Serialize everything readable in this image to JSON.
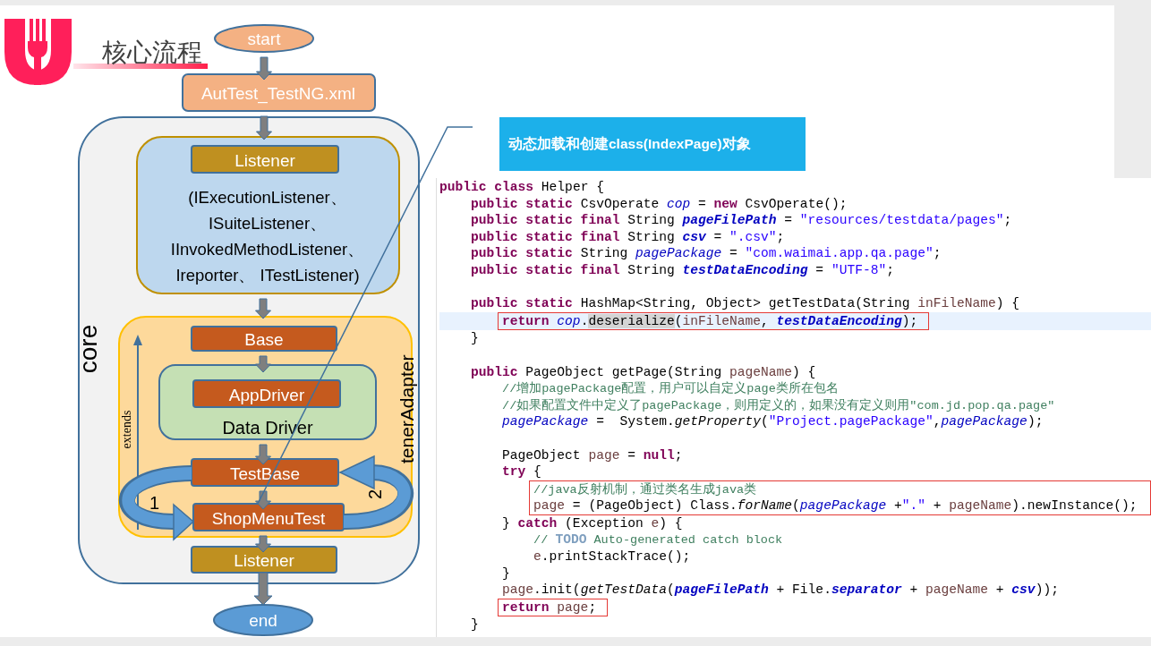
{
  "slide": {
    "title": "核心流程"
  },
  "flow": {
    "start": "start",
    "config_file": "AutTest_TestNG.xml",
    "container": "core",
    "listener_panel": {
      "title": "Listener",
      "lines": [
        "(IExecutionListener、",
        "ISuiteListener、",
        "IInvokedMethodListener、",
        "Ireporter、 ITestListener)"
      ]
    },
    "base": "Base",
    "driver_panel": {
      "title": "AppDriver",
      "label": "Data Driver"
    },
    "extends": "extends",
    "test_base": "TestBase",
    "test_class": "ShopMenuTest",
    "adapter": "tenerAdapter",
    "loop_labels": [
      "1",
      "2"
    ],
    "listener": "Listener",
    "end": "end"
  },
  "callout": {
    "text": "动态加载和创建class(IndexPage)对象"
  },
  "code": {
    "lines": [
      {
        "kind": "code",
        "tokens": [
          {
            "kind": "kw",
            "text": "public class"
          },
          {
            "kind": "p",
            "text": " Helper {"
          }
        ]
      },
      {
        "kind": "code",
        "tokens": [
          {
            "kind": "kw",
            "text": "    public static"
          },
          {
            "kind": "p",
            "text": " CsvOperate "
          },
          {
            "kind": "sf",
            "text": "cop"
          },
          {
            "kind": "p",
            "text": " = "
          },
          {
            "kind": "kw",
            "text": "new"
          },
          {
            "kind": "p",
            "text": " CsvOperate();"
          }
        ]
      },
      {
        "kind": "code",
        "tokens": [
          {
            "kind": "kw",
            "text": "    public static final"
          },
          {
            "kind": "p",
            "text": " String "
          },
          {
            "kind": "cf",
            "text": "pageFilePath"
          },
          {
            "kind": "p",
            "text": " = "
          },
          {
            "kind": "s",
            "text": "\"resources/testdata/pages\""
          },
          {
            "kind": "p",
            "text": ";"
          }
        ]
      },
      {
        "kind": "code",
        "tokens": [
          {
            "kind": "kw",
            "text": "    public static final"
          },
          {
            "kind": "p",
            "text": " String "
          },
          {
            "kind": "cf",
            "text": "csv"
          },
          {
            "kind": "p",
            "text": " = "
          },
          {
            "kind": "s",
            "text": "\".csv\""
          },
          {
            "kind": "p",
            "text": ";"
          }
        ]
      },
      {
        "kind": "code",
        "tokens": [
          {
            "kind": "kw",
            "text": "    public static"
          },
          {
            "kind": "p",
            "text": " String "
          },
          {
            "kind": "sf",
            "text": "pagePackage"
          },
          {
            "kind": "p",
            "text": " = "
          },
          {
            "kind": "s",
            "text": "\"com.waimai.app.qa.page\""
          },
          {
            "kind": "p",
            "text": ";"
          }
        ]
      },
      {
        "kind": "code",
        "tokens": [
          {
            "kind": "kw",
            "text": "    public static final"
          },
          {
            "kind": "p",
            "text": " String "
          },
          {
            "kind": "cf",
            "text": "testDataEncoding"
          },
          {
            "kind": "p",
            "text": " = "
          },
          {
            "kind": "s",
            "text": "\"UTF-8\""
          },
          {
            "kind": "p",
            "text": ";"
          }
        ]
      },
      {
        "kind": "blank"
      },
      {
        "kind": "code",
        "tokens": [
          {
            "kind": "kw",
            "text": "    public static"
          },
          {
            "kind": "p",
            "text": " HashMap<String, Object> getTestData(String "
          },
          {
            "kind": "l",
            "text": "inFileName"
          },
          {
            "kind": "p",
            "text": ") {"
          }
        ]
      },
      {
        "kind": "code",
        "current": true,
        "boxed": true,
        "tokens": [
          {
            "kind": "kw",
            "text": "        return"
          },
          {
            "kind": "sf",
            "text": " cop"
          },
          {
            "kind": "p",
            "text": "."
          },
          {
            "kind": "m",
            "text": "deserialize"
          },
          {
            "kind": "p",
            "text": "("
          },
          {
            "kind": "l",
            "text": "inFileName"
          },
          {
            "kind": "p",
            "text": ", "
          },
          {
            "kind": "cf",
            "text": "testDataEncoding"
          },
          {
            "kind": "p",
            "text": ");"
          }
        ]
      },
      {
        "kind": "code",
        "tokens": [
          {
            "kind": "p",
            "text": "    }"
          }
        ]
      },
      {
        "kind": "blank"
      },
      {
        "kind": "code",
        "tokens": [
          {
            "kind": "kw",
            "text": "    public"
          },
          {
            "kind": "p",
            "text": " PageObject getPage(String "
          },
          {
            "kind": "l",
            "text": "pageName"
          },
          {
            "kind": "p",
            "text": ") {"
          }
        ]
      },
      {
        "kind": "code",
        "tokens": [
          {
            "kind": "c",
            "text": "        //增加pagePackage配置，用户可以自定义page类所在包名"
          }
        ]
      },
      {
        "kind": "code",
        "tokens": [
          {
            "kind": "c",
            "text": "        //如果配置文件中定义了pagePackage，则用定义的，如果没有定义则用\"com.jd.pop.qa.page\""
          }
        ]
      },
      {
        "kind": "code",
        "tokens": [
          {
            "kind": "sf",
            "text": "        pagePackage"
          },
          {
            "kind": "p",
            "text": " =  System."
          },
          {
            "kind": "i",
            "text": "getProperty"
          },
          {
            "kind": "p",
            "text": "("
          },
          {
            "kind": "s",
            "text": "\"Project.pagePackage\""
          },
          {
            "kind": "p",
            "text": ","
          },
          {
            "kind": "sf",
            "text": "pagePackage"
          },
          {
            "kind": "p",
            "text": ");"
          }
        ]
      },
      {
        "kind": "blank"
      },
      {
        "kind": "code",
        "tokens": [
          {
            "kind": "p",
            "text": "        PageObject "
          },
          {
            "kind": "l",
            "text": "page"
          },
          {
            "kind": "p",
            "text": " = "
          },
          {
            "kind": "kw",
            "text": "null"
          },
          {
            "kind": "p",
            "text": ";"
          }
        ]
      },
      {
        "kind": "code",
        "tokens": [
          {
            "kind": "kw",
            "text": "        try"
          },
          {
            "kind": "p",
            "text": " {"
          }
        ]
      },
      {
        "kind": "code",
        "boxed": true,
        "tokens": [
          {
            "kind": "c",
            "text": "            //java反射机制，通过类名生成java类"
          }
        ]
      },
      {
        "kind": "code",
        "boxed": true,
        "tokens": [
          {
            "kind": "l",
            "text": "            page"
          },
          {
            "kind": "p",
            "text": " = (PageObject) Class."
          },
          {
            "kind": "i",
            "text": "forName"
          },
          {
            "kind": "p",
            "text": "("
          },
          {
            "kind": "sf",
            "text": "pagePackage"
          },
          {
            "kind": "p",
            "text": " +"
          },
          {
            "kind": "s",
            "text": "\".\""
          },
          {
            "kind": "p",
            "text": " + "
          },
          {
            "kind": "l",
            "text": "pageName"
          },
          {
            "kind": "p",
            "text": ").newInstance();"
          }
        ]
      },
      {
        "kind": "code",
        "tokens": [
          {
            "kind": "p",
            "text": "        } "
          },
          {
            "kind": "kw",
            "text": "catch"
          },
          {
            "kind": "p",
            "text": " (Exception "
          },
          {
            "kind": "l",
            "text": "e"
          },
          {
            "kind": "p",
            "text": ") {"
          }
        ]
      },
      {
        "kind": "code",
        "tokens": [
          {
            "kind": "c",
            "text": "            // "
          },
          {
            "kind": "t",
            "text": "TODO"
          },
          {
            "kind": "c",
            "text": " Auto-generated catch block"
          }
        ]
      },
      {
        "kind": "code",
        "tokens": [
          {
            "kind": "l",
            "text": "            e"
          },
          {
            "kind": "p",
            "text": ".printStackTrace();"
          }
        ]
      },
      {
        "kind": "code",
        "tokens": [
          {
            "kind": "p",
            "text": "        }"
          }
        ]
      },
      {
        "kind": "code",
        "tokens": [
          {
            "kind": "l",
            "text": "        page"
          },
          {
            "kind": "p",
            "text": ".init("
          },
          {
            "kind": "i",
            "text": "getTestData"
          },
          {
            "kind": "p",
            "text": "("
          },
          {
            "kind": "cf",
            "text": "pageFilePath"
          },
          {
            "kind": "p",
            "text": " + File."
          },
          {
            "kind": "cf",
            "text": "separator"
          },
          {
            "kind": "p",
            "text": " + "
          },
          {
            "kind": "l",
            "text": "pageName"
          },
          {
            "kind": "p",
            "text": " + "
          },
          {
            "kind": "cf",
            "text": "csv"
          },
          {
            "kind": "p",
            "text": "));"
          }
        ]
      },
      {
        "kind": "code",
        "boxed": true,
        "tokens": [
          {
            "kind": "kw",
            "text": "        return"
          },
          {
            "kind": "l",
            "text": " page"
          },
          {
            "kind": "p",
            "text": ";"
          }
        ]
      },
      {
        "kind": "code",
        "tokens": [
          {
            "kind": "p",
            "text": "    }"
          }
        ]
      }
    ]
  }
}
